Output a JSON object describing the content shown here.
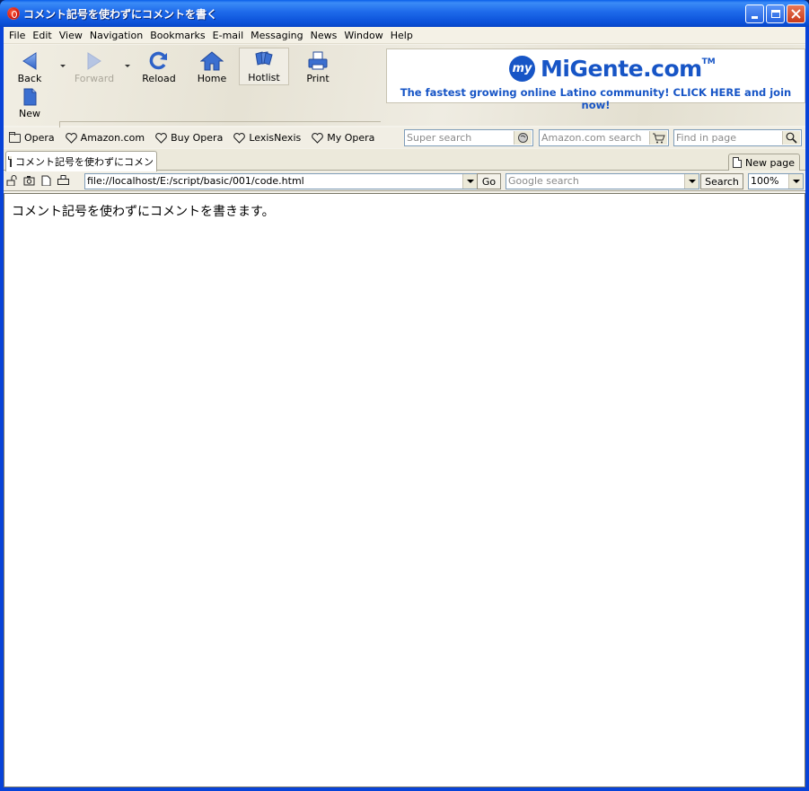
{
  "window": {
    "title": "コメント記号を使わずにコメントを書く"
  },
  "menu": {
    "items": [
      {
        "label": "File"
      },
      {
        "label": "Edit"
      },
      {
        "label": "View"
      },
      {
        "label": "Navigation"
      },
      {
        "label": "Bookmarks"
      },
      {
        "label": "E-mail"
      },
      {
        "label": "Messaging"
      },
      {
        "label": "News"
      },
      {
        "label": "Window"
      },
      {
        "label": "Help"
      }
    ]
  },
  "toolbar": {
    "back": "Back",
    "forward": "Forward",
    "reload": "Reload",
    "home": "Home",
    "hotlist": "Hotlist",
    "print": "Print",
    "new": "New"
  },
  "banner": {
    "my": "my",
    "brand": "MiGente.com",
    "tm": "TM",
    "tagline": "The fastest growing online Latino community! CLICK HERE and join now!"
  },
  "personal_bar": {
    "items": [
      {
        "label": "Opera",
        "icon": "folder-icon"
      },
      {
        "label": "Amazon.com",
        "icon": "heart-icon"
      },
      {
        "label": "Buy Opera",
        "icon": "heart-icon"
      },
      {
        "label": "LexisNexis",
        "icon": "heart-icon"
      },
      {
        "label": "My Opera",
        "icon": "heart-icon"
      }
    ],
    "super_search_placeholder": "Super search",
    "amazon_search_placeholder": "Amazon.com search",
    "find_placeholder": "Find in page"
  },
  "tabs": {
    "active_tab": "コメント記号を使わずにコメント...",
    "new_page": "New page"
  },
  "address": {
    "url": "file://localhost/E:/script/basic/001/code.html",
    "go": "Go",
    "google_placeholder": "Google search",
    "search_button": "Search",
    "zoom": "100%"
  },
  "content": {
    "text": "コメント記号を使わずにコメントを書きます。"
  },
  "colors": {
    "titlebar": "#0a5fe8",
    "banner_blue": "#1755c6",
    "frame": "#ece9d8"
  }
}
